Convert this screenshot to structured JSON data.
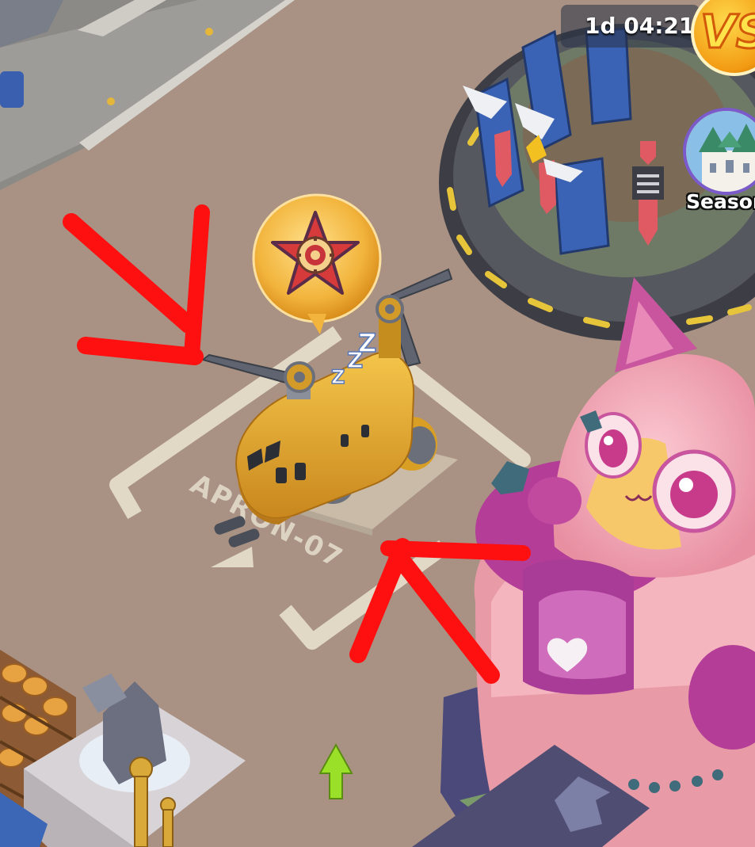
{
  "hud": {
    "timer_text": "1d 04:21",
    "vs_text": "VS",
    "season_label": "Season"
  },
  "map": {
    "pad_label": "APRON-07",
    "helicopter_state": "zzz"
  },
  "colors": {
    "ground": "#a99283",
    "annotation_red": "#ff1010",
    "helicopter_yellow": "#e3a92a",
    "badge_gold": "#f2b43c",
    "cat_pink": "#f2a6b3",
    "cat_purple": "#b23c9a"
  },
  "icons": [
    "star-gear-icon",
    "vs-icon",
    "season-castle-icon",
    "up-arrow-icon",
    "heart-icon"
  ]
}
